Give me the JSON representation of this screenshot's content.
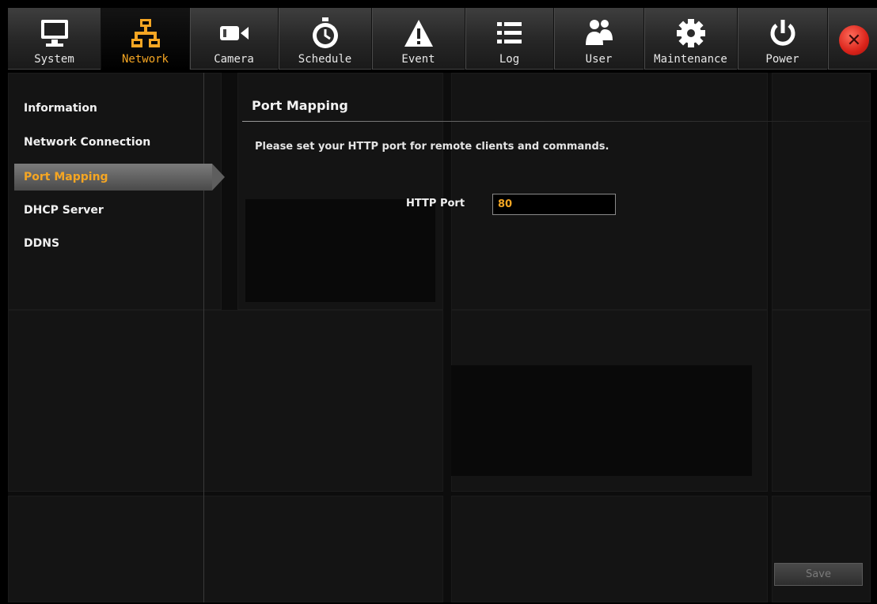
{
  "toolbar": {
    "tabs": [
      {
        "label": "System",
        "icon": "monitor-icon"
      },
      {
        "label": "Network",
        "icon": "network-icon"
      },
      {
        "label": "Camera",
        "icon": "camera-icon"
      },
      {
        "label": "Schedule",
        "icon": "stopwatch-icon"
      },
      {
        "label": "Event",
        "icon": "warning-icon"
      },
      {
        "label": "Log",
        "icon": "list-icon"
      },
      {
        "label": "User",
        "icon": "users-icon"
      },
      {
        "label": "Maintenance",
        "icon": "gear-icon"
      },
      {
        "label": "Power",
        "icon": "power-icon"
      }
    ],
    "active_tab": "Network",
    "close_icon": "close-icon",
    "accent_color": "#f5a623"
  },
  "sidebar": {
    "items": [
      {
        "label": "Information"
      },
      {
        "label": "Network Connection"
      },
      {
        "label": "Port Mapping"
      },
      {
        "label": "DHCP Server"
      },
      {
        "label": "DDNS"
      }
    ],
    "active_item": "Port Mapping"
  },
  "main": {
    "title": "Port Mapping",
    "description": "Please set your HTTP port for remote clients and commands.",
    "http_port_label": "HTTP Port",
    "http_port_value": "80",
    "save_label": "Save"
  }
}
